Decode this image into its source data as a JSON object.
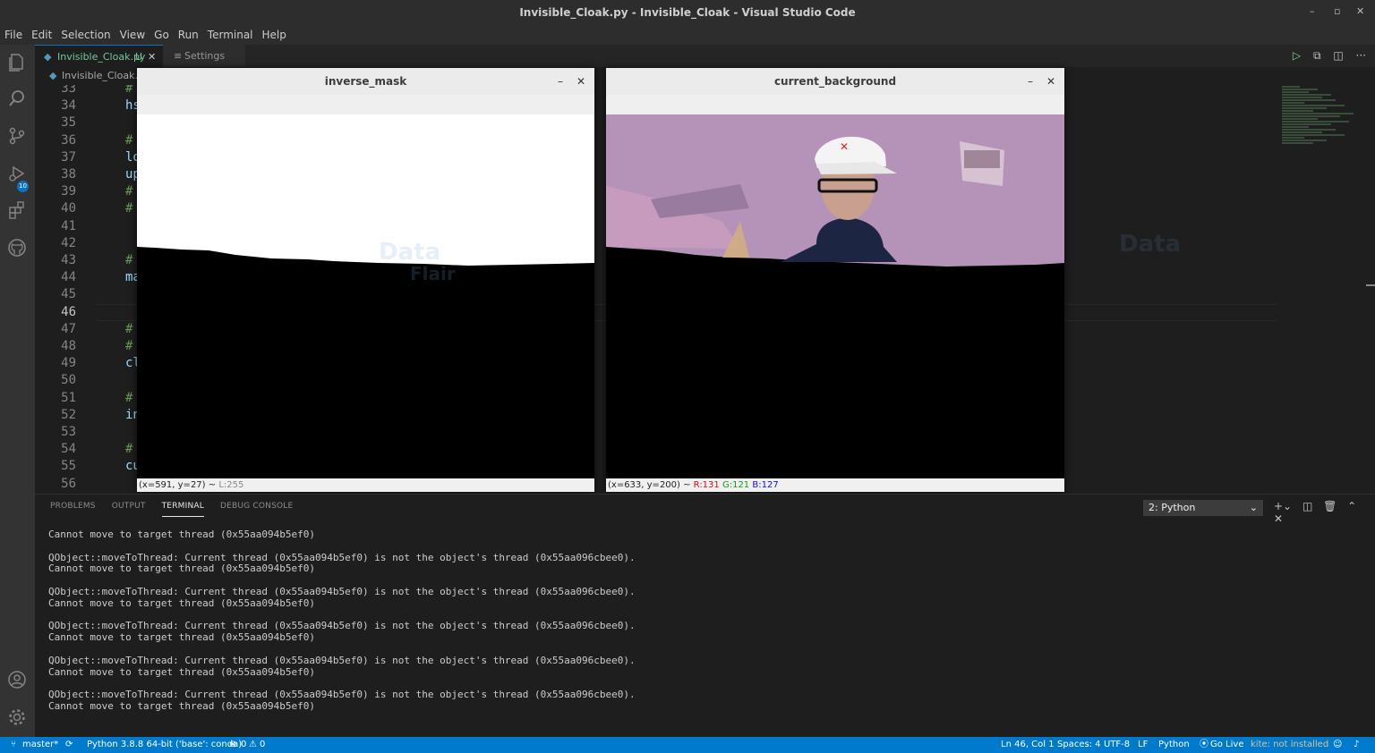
{
  "window": {
    "title": "Invisible_Cloak.py - Invisible_Cloak - Visual Studio Code",
    "minimize": "–",
    "maximize": "▫",
    "close": "✕"
  },
  "menu": [
    "File",
    "Edit",
    "Selection",
    "View",
    "Go",
    "Run",
    "Terminal",
    "Help"
  ],
  "activity_badge": "10",
  "tabs": {
    "active": {
      "label": "Invisible_Cloak.py",
      "status": "U",
      "close": "✕"
    },
    "settings": {
      "label": "Settings",
      "icon": "≡"
    }
  },
  "breadcrumb": "Invisible_Cloak.py",
  "editor": {
    "line_numbers": [
      "33",
      "34",
      "35",
      "36",
      "37",
      "38",
      "39",
      "40",
      "41",
      "42",
      "43",
      "44",
      "45",
      "46",
      "47",
      "48",
      "49",
      "50",
      "51",
      "52",
      "53",
      "54",
      "55",
      "56"
    ],
    "current_line": "46",
    "visible_fragments": [
      {
        "line": "33",
        "text": "#",
        "kind": "comment"
      },
      {
        "line": "34",
        "text": "hs",
        "kind": "code"
      },
      {
        "line": "36",
        "text": "#",
        "kind": "comment"
      },
      {
        "line": "37",
        "text": "lo",
        "kind": "code"
      },
      {
        "line": "38",
        "text": "up",
        "kind": "code"
      },
      {
        "line": "39",
        "text": "#",
        "kind": "comment"
      },
      {
        "line": "40",
        "text": "#",
        "kind": "comment"
      },
      {
        "line": "43",
        "text": "#",
        "kind": "comment"
      },
      {
        "line": "44",
        "text": "ma",
        "kind": "code"
      },
      {
        "line": "47",
        "text": "#",
        "kind": "comment"
      },
      {
        "line": "48",
        "text": "#",
        "kind": "comment"
      },
      {
        "line": "49",
        "text": "cl",
        "kind": "code"
      },
      {
        "line": "51",
        "text": "#",
        "kind": "comment"
      },
      {
        "line": "52",
        "text": "in",
        "kind": "code"
      },
      {
        "line": "54",
        "text": "#",
        "kind": "comment"
      },
      {
        "line": "55",
        "text": "cu",
        "kind": "code"
      }
    ]
  },
  "cv_windows": {
    "inverse_mask": {
      "title": "inverse_mask",
      "status_coords": "(x=591, y=27) ~ ",
      "status_value": "L:255"
    },
    "current_background": {
      "title": "current_background",
      "status_coords": "(x=633, y=200) ~ ",
      "r": "R:131",
      "g": "G:121",
      "b": "B:127"
    }
  },
  "panel": {
    "tabs": [
      "PROBLEMS",
      "OUTPUT",
      "TERMINAL",
      "DEBUG CONSOLE"
    ],
    "active_tab": "TERMINAL",
    "terminal_select": "2: Python",
    "terminal_lines": [
      "Cannot move to target thread (0x55aa094b5ef0)",
      "",
      "QObject::moveToThread: Current thread (0x55aa094b5ef0) is not the object's thread (0x55aa096cbee0).",
      "Cannot move to target thread (0x55aa094b5ef0)",
      "",
      "QObject::moveToThread: Current thread (0x55aa094b5ef0) is not the object's thread (0x55aa096cbee0).",
      "Cannot move to target thread (0x55aa094b5ef0)",
      "",
      "QObject::moveToThread: Current thread (0x55aa094b5ef0) is not the object's thread (0x55aa096cbee0).",
      "Cannot move to target thread (0x55aa094b5ef0)",
      "",
      "QObject::moveToThread: Current thread (0x55aa094b5ef0) is not the object's thread (0x55aa096cbee0).",
      "Cannot move to target thread (0x55aa094b5ef0)",
      "",
      "QObject::moveToThread: Current thread (0x55aa094b5ef0) is not the object's thread (0x55aa096cbee0).",
      "Cannot move to target thread (0x55aa094b5ef0)"
    ]
  },
  "statusbar": {
    "branch": "master*",
    "python": "Python 3.8.8 64-bit ('base': conda)",
    "errors": "0",
    "warnings": "0",
    "position": "Ln 46, Col 1",
    "spaces": "Spaces: 4",
    "encoding": "UTF-8",
    "eol": "LF",
    "language": "Python",
    "golive": "Go Live",
    "kite": "kite: not installed"
  },
  "watermark": {
    "line1": "Data",
    "line2": "Flair"
  },
  "colors": {
    "accent": "#007acc",
    "kite_warning": "#e2c08d",
    "untracked": "#73c991",
    "r": "#d01010",
    "g": "#10a010",
    "b": "#1010d0"
  }
}
